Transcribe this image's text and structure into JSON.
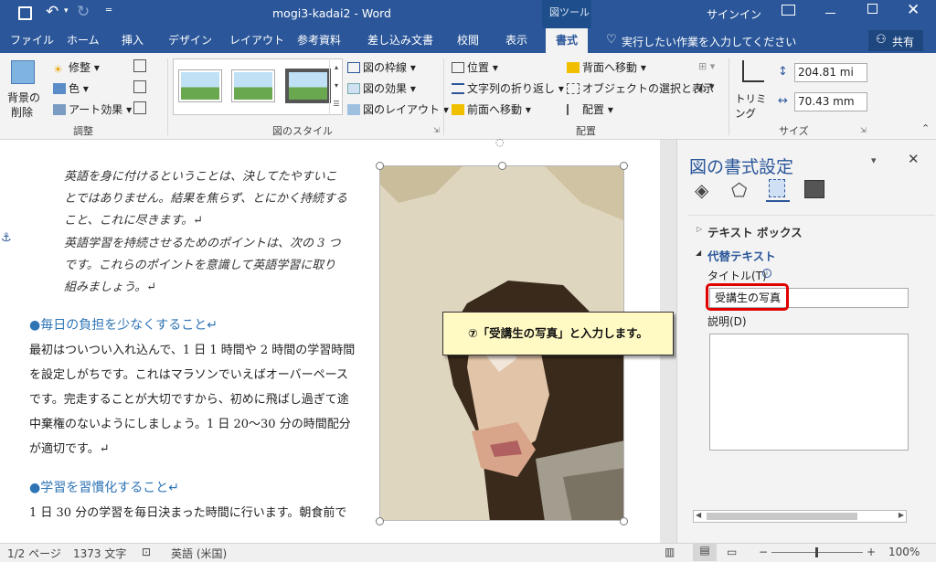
{
  "title_bar": {
    "doc_title": "mogi3-kadai2 - Word",
    "context_tool": "図ツール",
    "signin": "サインイン"
  },
  "tabs": [
    {
      "label": "ファイル"
    },
    {
      "label": "ホーム"
    },
    {
      "label": "挿入"
    },
    {
      "label": "デザイン"
    },
    {
      "label": "レイアウト"
    },
    {
      "label": "参考資料"
    },
    {
      "label": "差し込み文書"
    },
    {
      "label": "校閲"
    },
    {
      "label": "表示"
    },
    {
      "label": "書式"
    }
  ],
  "tell_me": "実行したい作業を入力してください",
  "share": "共有",
  "ribbon": {
    "remove_bg": "背景の",
    "remove_bg2": "削除",
    "corrections": "修整",
    "color": "色",
    "artistic": "アート効果",
    "group_adjust": "調整",
    "group_styles": "図のスタイル",
    "border": "図の枠線",
    "effects": "図の効果",
    "layout": "図のレイアウト",
    "position": "位置",
    "wrap": "文字列の折り返し",
    "bring_forward": "前面へ移動",
    "send_backward": "背面へ移動",
    "selection_pane": "オブジェクトの選択と表示",
    "align": "配置",
    "group_arrange": "配置",
    "crop": "トリミング",
    "height": "204.81 mi",
    "width": "70.43 mm",
    "group_size": "サイズ"
  },
  "document": {
    "italic_lines": [
      "英語を身に付けるということは、決してたやすいこ",
      "とではありません。結果を焦らず、とにかく持続する",
      "こと、これに尽きます。↵",
      "英語学習を持続させるためのポイントは、次の 3 つ",
      "です。これらのポイントを意識して英語学習に取り",
      "組みましょう。↵"
    ],
    "heading1": "●毎日の負担を少なくすること↵",
    "para1": [
      "最初はついつい入れ込んで、1 日 1 時間や 2 時間の学習時間",
      "を設定しがちです。これはマラソンでいえばオーバーペース",
      "です。完走することが大切ですから、初めに飛ばし過ぎて途",
      "中棄権のないようにしましょう。1 日 20～30 分の時間配分",
      "が適切です。↵"
    ],
    "heading2": "●学習を習慣化すること↵",
    "para2": "1 日 30 分の学習を毎日決まった時間に行います。朝食前で"
  },
  "callout": "⑦「受講生の写真」と入力します。",
  "pane": {
    "title": "図の書式設定",
    "section_textbox": "テキスト ボックス",
    "section_alt": "代替テキスト",
    "title_label": "タイトル(T)",
    "title_value": "受講生の写真",
    "desc_label": "説明(D)"
  },
  "status": {
    "page": "1/2 ページ",
    "words": "1373 文字",
    "lang": "英語 (米国)",
    "zoom": "100%"
  },
  "colors": {
    "accent": "#2b579a",
    "highlight": "#e00000",
    "callout_bg": "#fff9c4"
  }
}
